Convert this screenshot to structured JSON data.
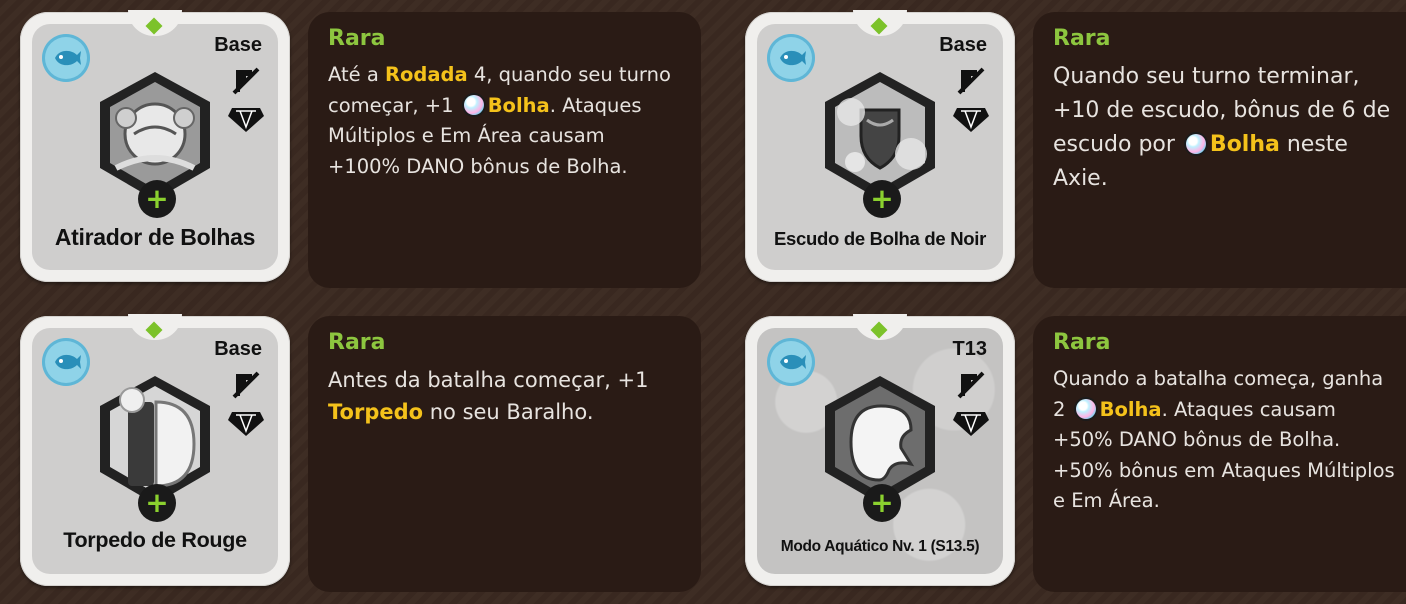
{
  "cards": [
    {
      "tier": "Base",
      "name": "Atirador de Bolhas",
      "rarity": "Rara",
      "desc": [
        {
          "t": "Até a "
        },
        {
          "t": "Rodada",
          "kw": true
        },
        {
          "t": " 4, quando seu turno começar, +1 "
        },
        {
          "icon": "bubble-icon"
        },
        {
          "t": "Bolha",
          "kw": true
        },
        {
          "t": ". Ataques Múltiplos e Em Área causam +100% DANO bônus de Bolha."
        }
      ]
    },
    {
      "tier": "Base",
      "name": "Escudo de Bolha de Noir",
      "rarity": "Rara",
      "desc": [
        {
          "t": "Quando seu turno terminar, +10 de escudo, bônus de 6 de escudo por "
        },
        {
          "icon": "bubble-icon"
        },
        {
          "t": "Bolha",
          "kw": true
        },
        {
          "t": " neste Axie."
        }
      ]
    },
    {
      "tier": "Base",
      "name": "Torpedo de Rouge",
      "rarity": "Rara",
      "desc": [
        {
          "t": "Antes da batalha começar, +1 "
        },
        {
          "t": "Torpedo",
          "kw": true
        },
        {
          "t": " no seu Baralho."
        }
      ]
    },
    {
      "tier": "T13",
      "name": "Modo Aquático Nv. 1 (S13.5)",
      "rarity": "Rara",
      "desc": [
        {
          "t": "Quando a batalha começa, ganha 2 "
        },
        {
          "icon": "bubble-icon"
        },
        {
          "t": "Bolha",
          "kw": true
        },
        {
          "t": ". Ataques causam +50% DANO bônus de Bolha. +50% bônus em Ataques Múltiplos e Em Área."
        }
      ]
    }
  ],
  "icons": {
    "class": "aquatic-class-icon",
    "no_energy": "no-energy-icon",
    "gem": "gem-icon",
    "plus": "plus-icon",
    "bubble": "bubble-icon"
  },
  "colors": {
    "rarity": "#8dc63f",
    "keyword": "#f4c21b",
    "desc_text": "#e7e3df",
    "desc_bg": "#2a1b15",
    "page_bg": "#3b2a21"
  }
}
